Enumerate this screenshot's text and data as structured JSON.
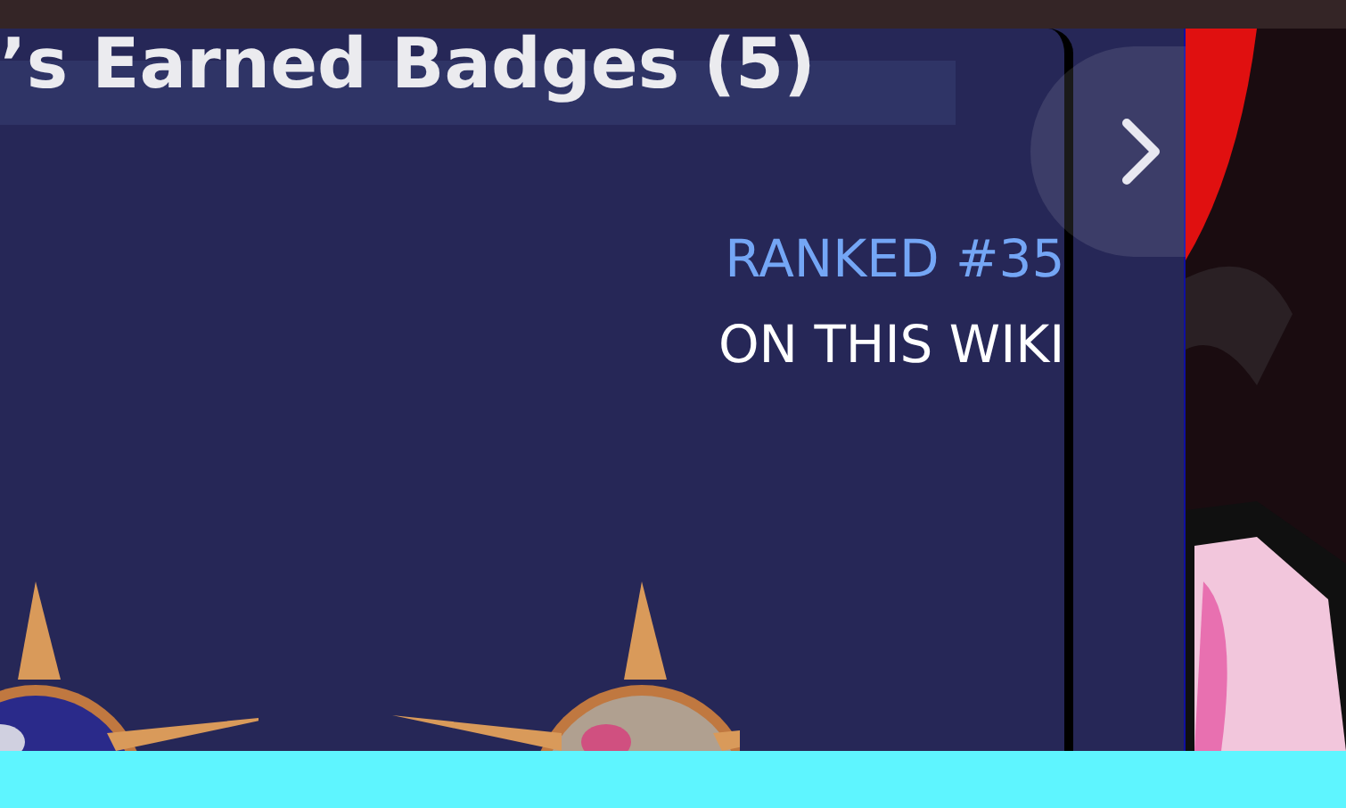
{
  "header": {
    "title": "’s Earned Badges (5)"
  },
  "rank": {
    "position": "RANKED #35",
    "scope": "ON THIS WIKI"
  }
}
